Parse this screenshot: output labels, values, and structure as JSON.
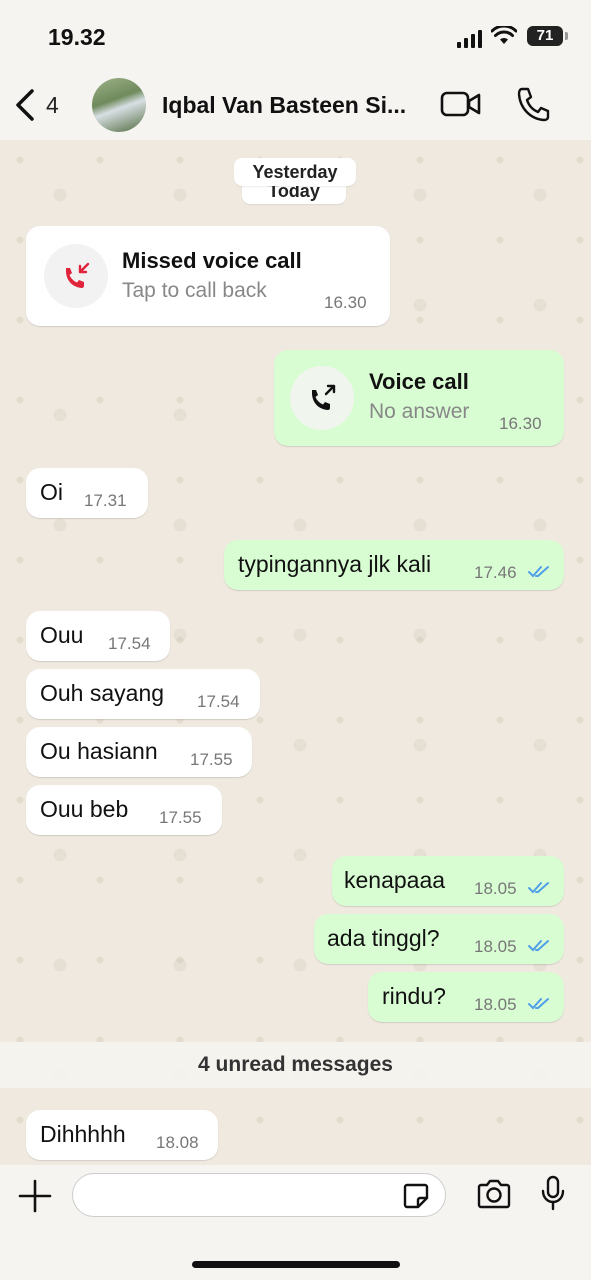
{
  "status_bar": {
    "time": "19.32",
    "battery": "71"
  },
  "header": {
    "back_count": "4",
    "contact_name": "Iqbal Van Basteen Si..."
  },
  "date_chips": {
    "yesterday": "Yesterday",
    "today": "Today"
  },
  "calls": {
    "missed": {
      "title": "Missed voice call",
      "subtitle": "Tap to call back",
      "time": "16.30"
    },
    "outgoing": {
      "title": "Voice call",
      "subtitle": "No answer",
      "time": "16.30"
    }
  },
  "messages": [
    {
      "direction": "in",
      "text": "Oi",
      "time": "17.31"
    },
    {
      "direction": "out",
      "text": "typingannya jlk kali",
      "time": "17.46",
      "status": "read"
    },
    {
      "direction": "in",
      "text": "Ouu",
      "time": "17.54"
    },
    {
      "direction": "in",
      "text": "Ouh sayang",
      "time": "17.54"
    },
    {
      "direction": "in",
      "text": "Ou hasiann",
      "time": "17.55"
    },
    {
      "direction": "in",
      "text": "Ouu beb",
      "time": "17.55"
    },
    {
      "direction": "out",
      "text": "kenapaaa",
      "time": "18.05",
      "status": "read"
    },
    {
      "direction": "out",
      "text": "ada tinggl?",
      "time": "18.05",
      "status": "read"
    },
    {
      "direction": "out",
      "text": "rindu?",
      "time": "18.05",
      "status": "read"
    },
    {
      "direction": "in",
      "text": "Dihhhhh",
      "time": "18.08"
    }
  ],
  "unread_banner": "4 unread messages",
  "input_bar": {
    "placeholder": ""
  },
  "colors": {
    "outgoing_bubble": "#d9fdd3",
    "incoming_bubble": "#ffffff",
    "read_ticks": "#4f9fe8",
    "missed_call_red": "#e0243c"
  }
}
